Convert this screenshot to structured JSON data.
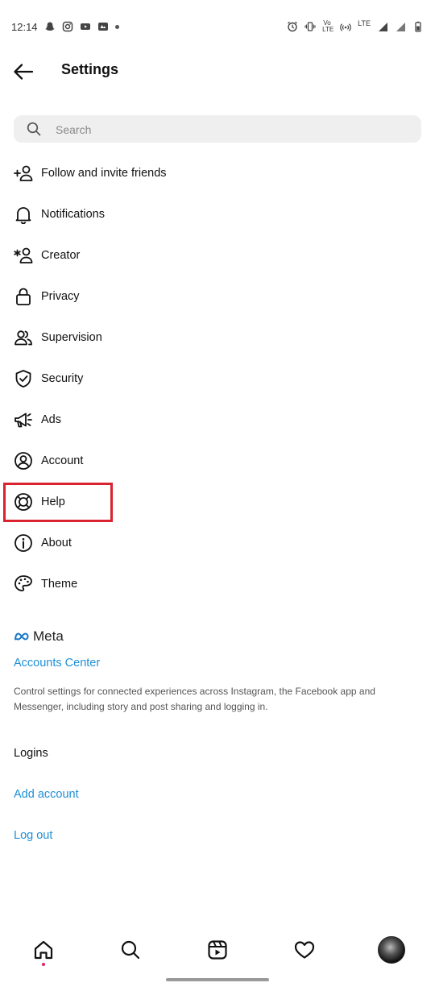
{
  "status_bar": {
    "time": "12:14",
    "left_icons": [
      "snapchat-icon",
      "instagram-icon",
      "youtube-icon",
      "app-badge-icon",
      "notification-dot-icon"
    ],
    "right_icons": [
      "alarm-icon",
      "vibrate-icon",
      "volte-icon",
      "hotspot-icon",
      "signal-icon",
      "battery-icon"
    ],
    "volte_label_top": "Vo ",
    "volte_label_bottom": "LTE",
    "network_label": "LTE"
  },
  "header": {
    "title": "Settings"
  },
  "search": {
    "placeholder": "Search",
    "value": ""
  },
  "menu": {
    "items": [
      {
        "label": "Follow and invite friends",
        "icon": "add-person-icon"
      },
      {
        "label": "Notifications",
        "icon": "bell-icon"
      },
      {
        "label": "Creator",
        "icon": "star-person-icon"
      },
      {
        "label": "Privacy",
        "icon": "lock-icon"
      },
      {
        "label": "Supervision",
        "icon": "people-icon"
      },
      {
        "label": "Security",
        "icon": "shield-check-icon"
      },
      {
        "label": "Ads",
        "icon": "megaphone-icon"
      },
      {
        "label": "Account",
        "icon": "user-circle-icon"
      },
      {
        "label": "Help",
        "icon": "lifebuoy-icon"
      },
      {
        "label": "About",
        "icon": "info-icon"
      },
      {
        "label": "Theme",
        "icon": "palette-icon"
      }
    ],
    "highlighted_item": "Help",
    "highlight_color": "#d9232e"
  },
  "meta": {
    "logo_text": "Meta",
    "accounts_center_label": "Accounts Center",
    "description": "Control settings for connected experiences across Instagram, the Facebook app and Messenger, including story and post sharing and logging in."
  },
  "logins": {
    "section_label": "Logins",
    "add_account_label": "Add account",
    "log_out_label": "Log out"
  },
  "bottom_nav": {
    "items": [
      "home-icon",
      "search-icon",
      "reels-icon",
      "heart-icon",
      "profile-avatar"
    ],
    "active": "home-icon"
  },
  "colors": {
    "link": "#1f8fd6",
    "search_bg": "#efefef",
    "highlight": "#d9232e"
  }
}
